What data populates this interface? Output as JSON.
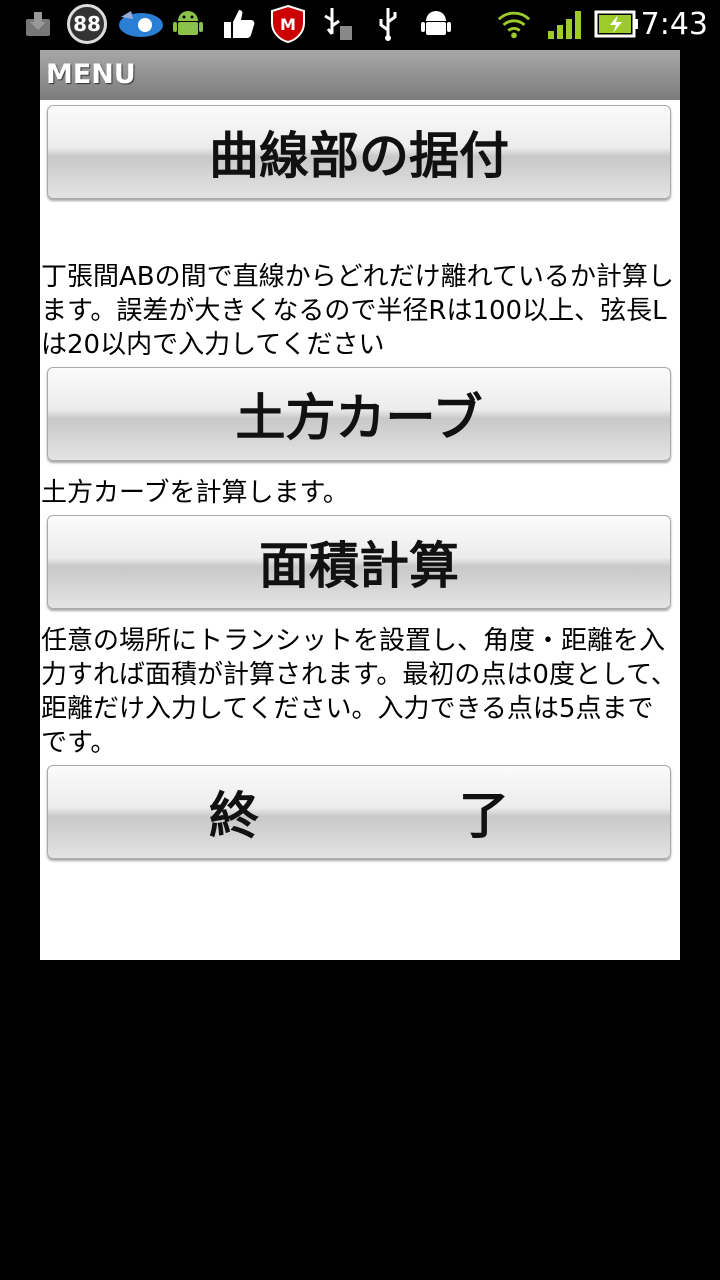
{
  "status_bar": {
    "time": "7:43",
    "badge_count": "88",
    "icons": [
      "download-icon",
      "badge-88-icon",
      "speed-app-icon",
      "android-icon",
      "thumbs-up-icon",
      "mcafee-icon",
      "usb-storage-icon",
      "usb-icon",
      "android-debug-icon",
      "wifi-icon",
      "signal-icon",
      "battery-charging-icon"
    ]
  },
  "app": {
    "title": "MENU",
    "buttons": [
      {
        "label": "曲線部の据付"
      },
      {
        "label": "土方カーブ"
      },
      {
        "label": "面積計算"
      },
      {
        "label": "終　　　　了"
      }
    ],
    "descriptions": [
      "丁張間ABの間で直線からどれだけ離れているか計算します。誤差が大きくなるので半径Rは100以上、弦長Lは20以内で入力してください",
      "土方カーブを計算します。",
      "任意の場所にトランシットを設置し、角度・距離を入力すれば面積が計算されます。最初の点は0度として、距離だけ入力してください。入力できる点は5点までです。"
    ]
  },
  "colors": {
    "title_bar": "#8e8e8e",
    "background": "#ffffff",
    "status_bar": "#000000",
    "signal": "#9ccb2a"
  }
}
